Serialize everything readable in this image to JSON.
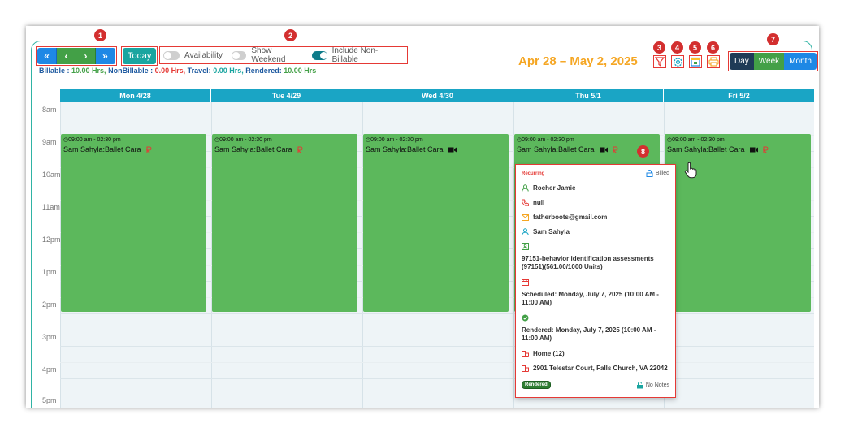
{
  "toolbar": {
    "nav": {
      "first": "«",
      "prev": "‹",
      "next": "›",
      "last": "»"
    },
    "today_label": "Today",
    "toggles": [
      {
        "label": "Availability",
        "on": false
      },
      {
        "label": "Show Weekend",
        "on": false
      },
      {
        "label": "Include Non-Billable",
        "on": true
      }
    ],
    "date_range": "Apr 28 – May 2, 2025",
    "views": {
      "day": "Day",
      "week": "Week",
      "month": "Month"
    },
    "icons": [
      "filter-icon",
      "settings-icon",
      "calendar-icon",
      "print-icon"
    ]
  },
  "badges": [
    "1",
    "2",
    "3",
    "4",
    "5",
    "6",
    "7",
    "8"
  ],
  "totals": {
    "billable_label": "Billable :",
    "billable_value": "10.00 Hrs,",
    "nonbillable_label": "NonBillable :",
    "nonbillable_value": "0.00 Hrs,",
    "travel_label": "Travel:",
    "travel_value": "0.00 Hrs,",
    "rendered_label": "Rendered:",
    "rendered_value": "10.00 Hrs"
  },
  "calendar": {
    "days": [
      "Mon 4/28",
      "Tue 4/29",
      "Wed 4/30",
      "Thu 5/1",
      "Fri 5/2"
    ],
    "hours": [
      "8am",
      "9am",
      "10am",
      "11am",
      "12pm",
      "1pm",
      "2pm",
      "3pm",
      "4pm",
      "5pm"
    ],
    "events": [
      {
        "time": "09:00 am - 02:30 pm",
        "title": "Sam Sahyla:Ballet Cara",
        "icons": [
          "recurring-icon"
        ]
      },
      {
        "time": "09:00 am - 02:30 pm",
        "title": "Sam Sahyla:Ballet Cara",
        "icons": [
          "recurring-icon"
        ]
      },
      {
        "time": "09:00 am - 02:30 pm",
        "title": "Sam Sahyla:Ballet Cara",
        "icons": [
          "video-icon"
        ]
      },
      {
        "time": "09:00 am - 02:30 pm",
        "title": "Sam Sahyla:Ballet Cara",
        "icons": [
          "video-icon",
          "recurring-icon"
        ]
      },
      {
        "time": "09:00 am - 02:30 pm",
        "title": "Sam Sahyla:Ballet Cara",
        "icons": [
          "video-icon",
          "recurring-icon"
        ]
      }
    ]
  },
  "popup": {
    "recurring": "Recurring",
    "billed": "Billed",
    "client": "Rocher Jamie",
    "phone": "null",
    "email": "fatherboots@gmail.com",
    "provider": "Sam Sahyla",
    "service": "97151-behavior identification assessments (97151)(561.00/1000 Units)",
    "scheduled": "Scheduled: Monday, July 7, 2025 (10:00 AM - 11:00 AM)",
    "rendered": "Rendered: Monday, July 7, 2025 (10:00 AM - 11:00 AM)",
    "location": "Home (12)",
    "address": "2901 Telestar Court, Falls Church, VA 22042",
    "status": "Rendered",
    "notes": "No Notes"
  },
  "colors": {
    "accent": "#1aa5c5",
    "event": "#5cb85c",
    "date_range": "#f5a623",
    "badge": "#d32f2f"
  }
}
